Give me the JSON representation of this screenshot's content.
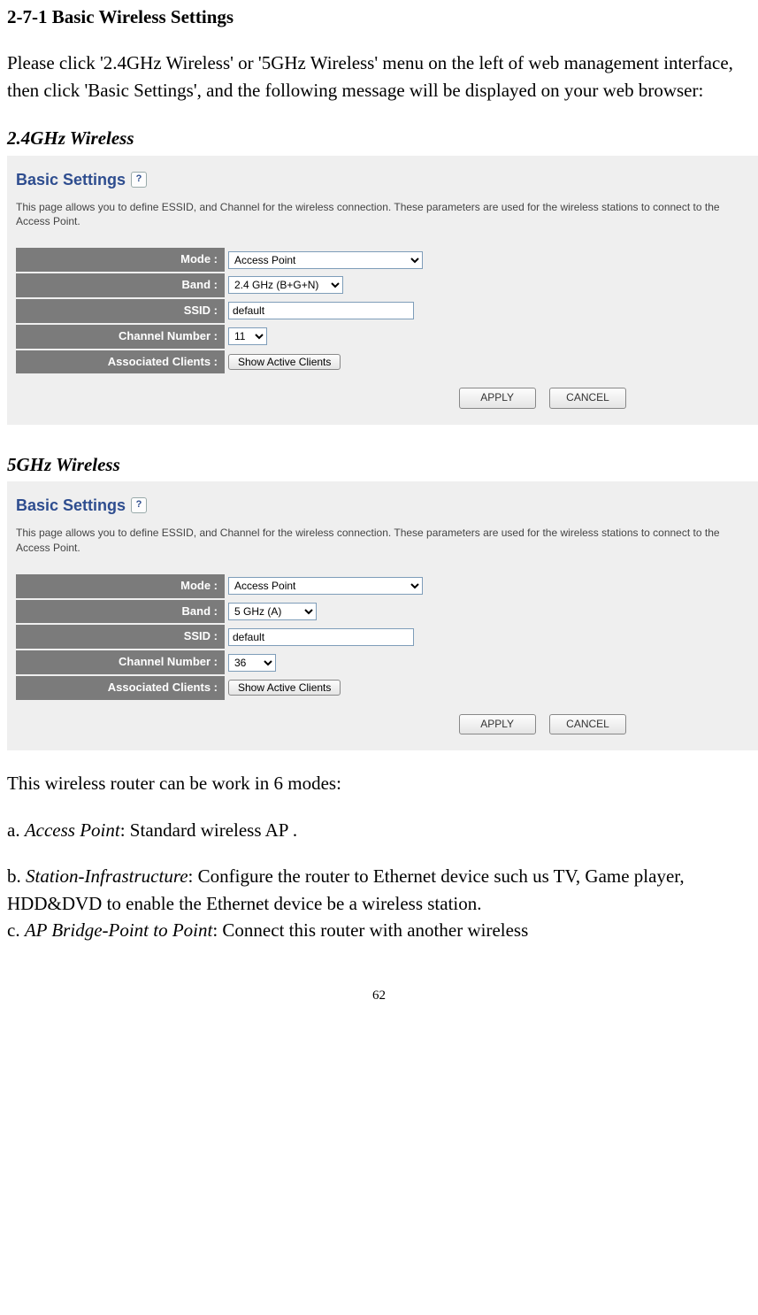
{
  "header": "2-7-1 Basic Wireless Settings",
  "intro": "Please click '2.4GHz Wireless' or '5GHz Wireless' menu on the left of web management interface, then click 'Basic Settings', and the following message will be displayed on your web browser:",
  "subh1": "2.4GHz Wireless",
  "subh2": "5GHz Wireless",
  "panel_title": "Basic Settings",
  "panel_desc": "This page allows you to define ESSID, and Channel for the wireless connection. These parameters are used for the wireless stations to connect to the Access Point.",
  "labels": {
    "mode": "Mode :",
    "band": "Band :",
    "ssid": "SSID :",
    "channel": "Channel Number :",
    "clients": "Associated Clients :"
  },
  "vals24": {
    "mode": "Access Point",
    "band": "2.4 GHz (B+G+N)",
    "ssid": "default",
    "channel": "11"
  },
  "vals5": {
    "mode": "Access Point",
    "band": "5 GHz (A)",
    "ssid": "default",
    "channel": "36"
  },
  "buttons": {
    "show": "Show Active Clients",
    "apply": "APPLY",
    "cancel": "CANCEL"
  },
  "body_after1": "This wireless router can be work in 6 modes:",
  "mode_a_pre": "a. ",
  "mode_a_name": "Access Point",
  "mode_a_post": ": Standard wireless AP .",
  "mode_b_pre": "b. ",
  "mode_b_name": "Station-Infrastructure",
  "mode_b_post": ": Configure the router to Ethernet device such us TV, Game player, HDD&DVD to enable the Ethernet device be a wireless station.",
  "mode_c_pre": "c. ",
  "mode_c_name": "AP Bridge-Point to Point",
  "mode_c_post": ": Connect this router with another wireless",
  "page_num": "62"
}
